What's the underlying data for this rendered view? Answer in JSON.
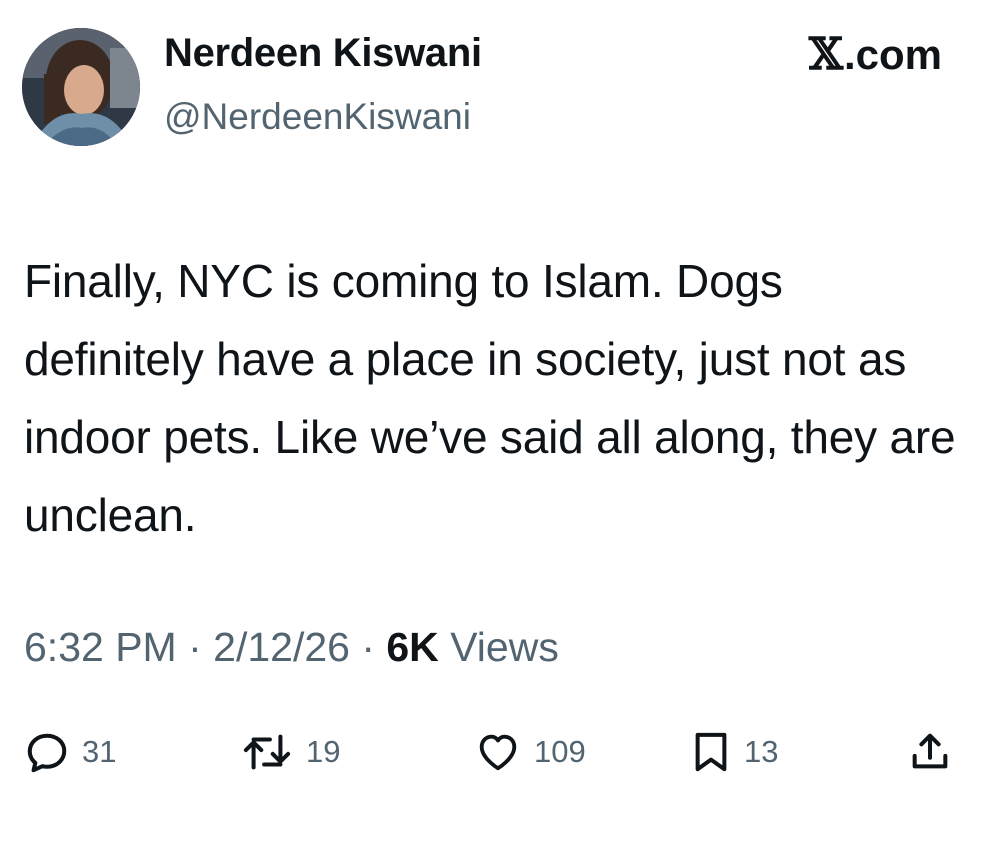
{
  "tweet": {
    "author": {
      "display_name": "Nerdeen Kiswani",
      "handle": "@NerdeenKiswani"
    },
    "brand": {
      "x_glyph": "𝕏",
      "domain": ".com"
    },
    "text": "Finally, NYC is coming to Islam. Dogs definitely have a place in society, just not as indoor pets. Like we’ve said all along, they are unclean.",
    "meta": {
      "time": "6:32 PM",
      "separator": " · ",
      "date": "2/12/26",
      "views_count": "6K",
      "views_label": " Views"
    },
    "actions": {
      "replies": "31",
      "reposts": "19",
      "likes": "109",
      "bookmarks": "13"
    }
  },
  "colors": {
    "text_primary": "#0f1419",
    "text_secondary": "#536471",
    "background": "#ffffff"
  },
  "icons": [
    "reply-icon",
    "repost-icon",
    "like-icon",
    "bookmark-icon",
    "share-icon"
  ]
}
